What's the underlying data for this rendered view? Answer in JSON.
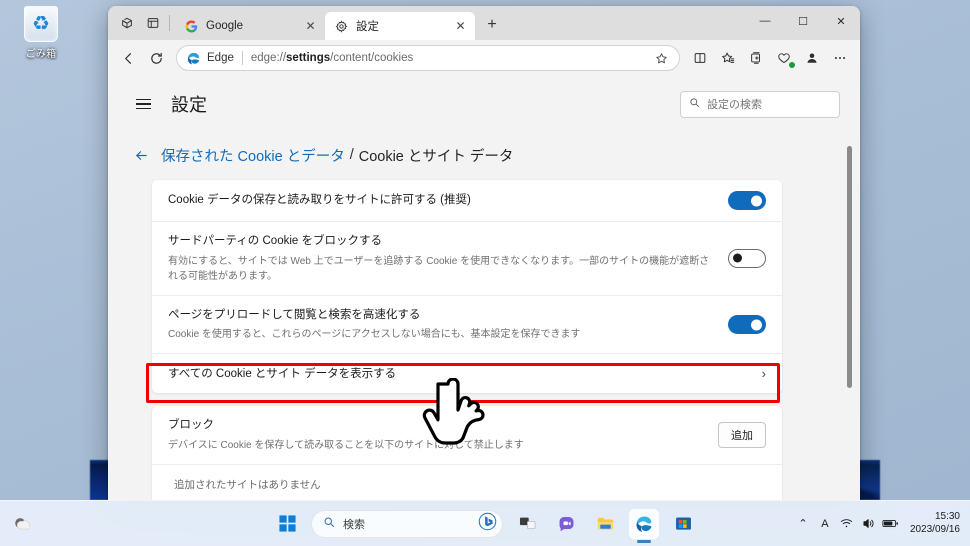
{
  "desktop": {
    "recycle_bin_label": "ごみ箱",
    "recycle_bin_icon": "recycle-bin-icon"
  },
  "browser": {
    "titlebar_icons": [
      "tab-actions-icon",
      "split-pane-icon"
    ],
    "tabs": [
      {
        "title": "Google",
        "favicon": "google-g-icon",
        "active": false,
        "close_label": "✕"
      },
      {
        "title": "設定",
        "favicon": "gear-icon",
        "active": true,
        "close_label": "✕"
      }
    ],
    "new_tab_label": "+",
    "window_controls": {
      "minimize": "—",
      "maximize": "☐",
      "close": "✕"
    },
    "toolbar": {
      "back_label": "←",
      "refresh_label": "⟳",
      "edge_brand_label": "Edge",
      "url_prefix": "edge://",
      "url_bold": "settings",
      "url_suffix": "/content/cookies",
      "favorite_icon": "star-icon",
      "right_icons": [
        "split-screen-icon",
        "favorites-icon",
        "collections-icon",
        "browser-essentials-icon",
        "profile-icon",
        "settings-more-icon"
      ]
    }
  },
  "settings": {
    "menu_icon": "hamburger-icon",
    "title": "設定",
    "search": {
      "icon": "search-icon",
      "placeholder": "設定の検索",
      "value": ""
    },
    "breadcrumb": {
      "back_icon": "back-arrow-icon",
      "parent": "保存された Cookie とデータ",
      "separator": "/",
      "current": "Cookie とサイト データ"
    },
    "rows": [
      {
        "name": "allow-cookies-row",
        "title": "Cookie データの保存と読み取りをサイトに許可する (推奨)",
        "desc": "",
        "control": "toggle",
        "toggle_state": "on"
      },
      {
        "name": "block-third-party-row",
        "title": "サードパーティの Cookie をブロックする",
        "desc": "有効にすると、サイトでは Web 上でユーザーを追跡する Cookie を使用できなくなります。一部のサイトの機能が遮断される可能性があります。",
        "control": "toggle",
        "toggle_state": "off"
      },
      {
        "name": "preload-pages-row",
        "title": "ページをプリロードして閲覧と検索を高速化する",
        "desc": "Cookie を使用すると、これらのページにアクセスしない場合にも、基本設定を保存できます",
        "control": "toggle",
        "toggle_state": "on"
      },
      {
        "name": "view-all-cookies-row",
        "title": "すべての Cookie とサイト データを表示する",
        "desc": "",
        "control": "chevron",
        "chevron_label": "›",
        "highlighted": true
      }
    ],
    "block_section": {
      "name": "block-section",
      "title": "ブロック",
      "desc": "デバイスに Cookie を保存して読み取ることを以下のサイトに対して禁止します",
      "add_button_label": "追加",
      "empty_text": "追加されたサイトはありません"
    },
    "highlight_color": "#ee0000",
    "accent_color": "#0f6cbd"
  },
  "taskbar": {
    "weather_icon": "weather-icon",
    "start_label": "start-icon",
    "search": {
      "icon": "search-icon",
      "placeholder": "検索",
      "value": "",
      "assistant_icon": "bing-chat-icon"
    },
    "items": [
      {
        "name": "taskbar-item-task-view",
        "icon": "task-view-icon",
        "active": false
      },
      {
        "name": "taskbar-item-chat",
        "icon": "chat-icon",
        "active": false
      },
      {
        "name": "taskbar-item-file-explorer",
        "icon": "file-explorer-icon",
        "active": false
      },
      {
        "name": "taskbar-item-edge",
        "icon": "edge-icon",
        "active": true
      },
      {
        "name": "taskbar-item-store",
        "icon": "microsoft-store-icon",
        "active": false
      }
    ],
    "tray": {
      "overflow_label": "⌃",
      "ime_label": "A",
      "wifi_icon": "wifi-icon",
      "volume_icon": "volume-icon",
      "battery_icon": "battery-icon",
      "time": "15:30",
      "date": "2023/09/16"
    }
  }
}
